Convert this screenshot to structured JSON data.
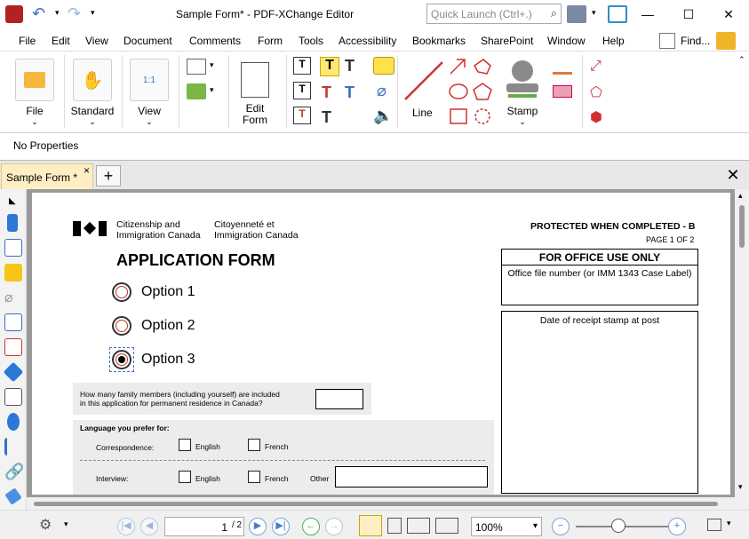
{
  "window": {
    "title": "Sample Form* - PDF-XChange Editor",
    "search_placeholder": "Quick Launch (Ctrl+.)",
    "min": "—",
    "max": "☐",
    "close": "✕"
  },
  "menu": [
    "File",
    "Edit",
    "View",
    "Document",
    "Comments",
    "Form",
    "Tools",
    "Accessibility",
    "Bookmarks",
    "SharePoint",
    "Window",
    "Help"
  ],
  "menu_find": "Find...",
  "ribbon": {
    "file": "File",
    "standard": "Standard",
    "view": "View",
    "edit_form_1": "Edit",
    "edit_form_2": "Form",
    "line": "Line",
    "stamp": "Stamp"
  },
  "props": "No Properties",
  "tab": {
    "label": "Sample Form *",
    "close": "×",
    "new": "+",
    "close_all": "✕"
  },
  "form": {
    "agency_en_1": "Citizenship and",
    "agency_en_2": "Immigration Canada",
    "agency_fr_1": "Citoyenneté et",
    "agency_fr_2": "Immigration Canada",
    "protected": "PROTECTED WHEN COMPLETED - B",
    "page_of": "PAGE 1 OF 2",
    "title": "APPLICATION FORM",
    "office_use": "FOR OFFICE USE ONLY",
    "office_file": "Office file number (or IMM 1343 Case Label)",
    "date_receipt": "Date of receipt stamp at post",
    "options": [
      "Option 1",
      "Option 2",
      "Option 3"
    ],
    "selected_option": "Option 3",
    "family_q_1": "How many family members (including yourself) are included",
    "family_q_2": "in this application for permanent residence in Canada?",
    "language_pref": "Language you prefer for:",
    "correspondence": "Correspondence:",
    "interview": "Interview:",
    "english": "English",
    "french": "French",
    "other": "Other"
  },
  "status": {
    "page_value": "1",
    "page_total": "/ 2",
    "zoom": "100%"
  }
}
